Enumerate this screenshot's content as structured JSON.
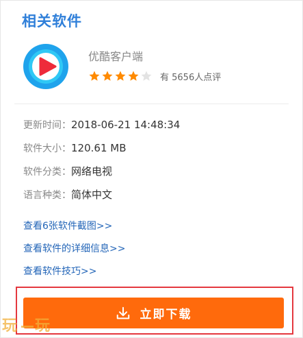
{
  "section": {
    "title": "相关软件"
  },
  "app": {
    "name": "优酷客户端",
    "logo_icon": "youku-logo-icon",
    "rating_stars_filled": 4,
    "rating_stars_total": 5,
    "rating_text": "有 5656人点评"
  },
  "info": {
    "update_label": "更新时间：",
    "update_value": "2018-06-21 14:48:34",
    "size_label": "软件大小：",
    "size_value": "120.61 MB",
    "category_label": "软件分类：",
    "category_value": "网络电视",
    "language_label": "语言种类：",
    "language_value": "简体中文"
  },
  "links": {
    "screenshots": "查看6张软件截图>>",
    "details": "查看软件的详细信息>>",
    "tips": "查看软件技巧>>"
  },
  "download": {
    "label": "立即下载",
    "icon": "download-icon"
  },
  "watermark": {
    "text_left": "玩",
    "text_right": "玩"
  },
  "colors": {
    "title_blue": "#2f7fd9",
    "link_blue": "#2466b8",
    "star_orange": "#ff8a00",
    "button_orange": "#ff6a0c",
    "highlight_red": "#e4373e"
  }
}
